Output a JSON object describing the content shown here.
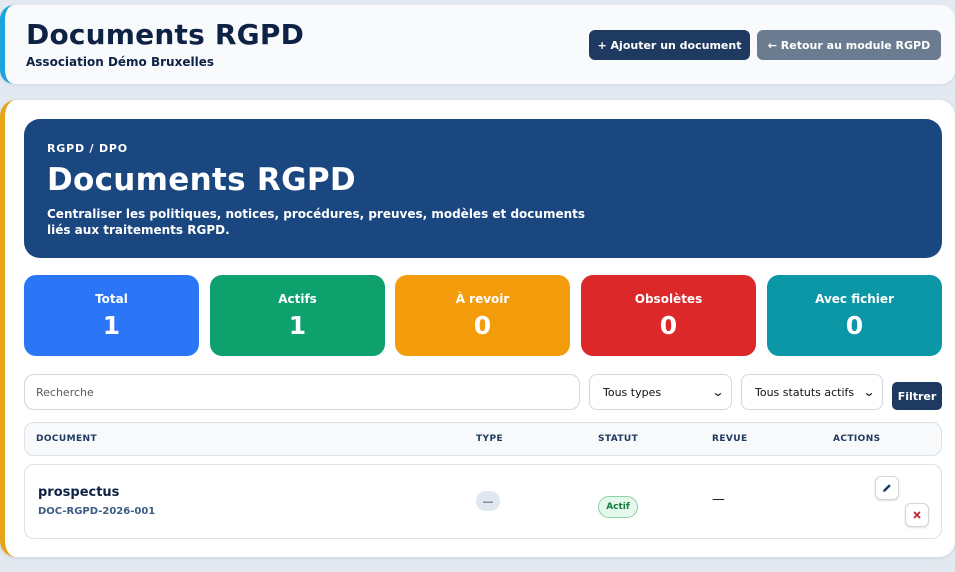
{
  "header": {
    "title": "Documents RGPD",
    "subtitle": "Association Démo Bruxelles",
    "add_label": "+ Ajouter un document",
    "back_label": "← Retour au module RGPD"
  },
  "hero": {
    "kicker": "RGPD / DPO",
    "title": "Documents RGPD",
    "description": "Centraliser les politiques, notices, procédures, preuves, modèles et documents liés aux traitements RGPD."
  },
  "stats": [
    {
      "label": "Total",
      "value": "1",
      "color": "#2a76f7"
    },
    {
      "label": "Actifs",
      "value": "1",
      "color": "#0fa16d"
    },
    {
      "label": "À revoir",
      "value": "0",
      "color": "#f39c0b"
    },
    {
      "label": "Obsolètes",
      "value": "0",
      "color": "#dc2828"
    },
    {
      "label": "Avec fichier",
      "value": "0",
      "color": "#0b97a6"
    }
  ],
  "filters": {
    "search_placeholder": "Recherche",
    "type_selected": "Tous types",
    "status_selected": "Tous statuts actifs",
    "filter_label": "Filtrer"
  },
  "table": {
    "columns": [
      "DOCUMENT",
      "TYPE",
      "STATUT",
      "REVUE",
      "ACTIONS"
    ],
    "rows": [
      {
        "name": "prospectus",
        "ref": "DOC-RGPD-2026-001",
        "type": "—",
        "status": "Actif",
        "review": "—",
        "actions": [
          "edit-icon",
          "delete-icon"
        ]
      }
    ]
  },
  "colors": {
    "navy": "#1f3a61",
    "hero": "#1a4780",
    "accent_top": "#1ea4dc",
    "accent_card": "#e8a417"
  }
}
